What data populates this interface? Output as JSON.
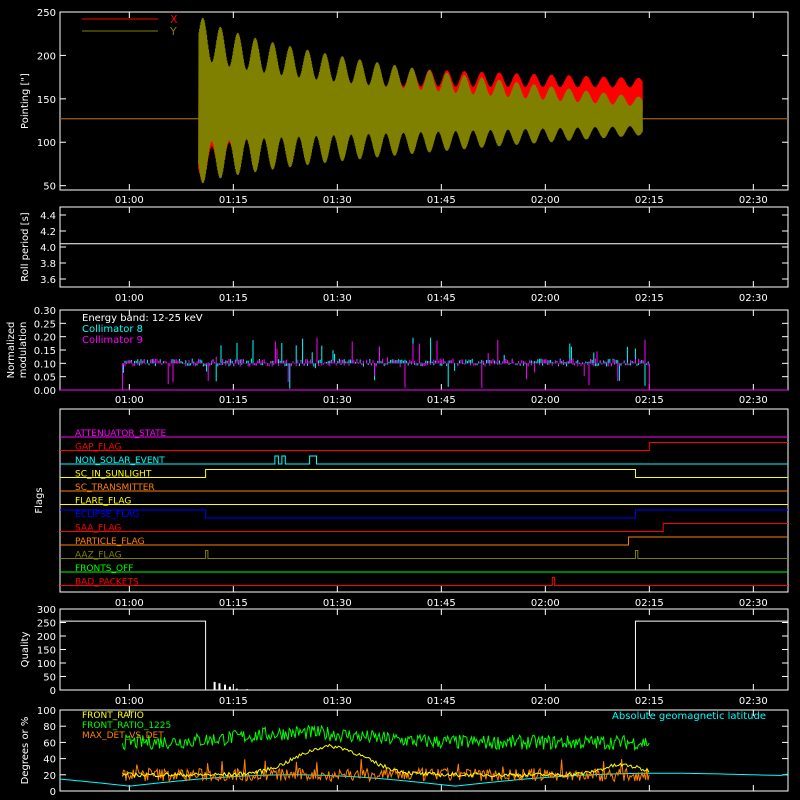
{
  "time_ticks": [
    "01:00",
    "01:15",
    "01:30",
    "01:45",
    "02:00",
    "02:15",
    "02:30"
  ],
  "chart_data": [
    {
      "type": "line",
      "panel": "pointing",
      "ylabel": "Pointing [\"]",
      "ylim": [
        45,
        250
      ],
      "yticks": [
        "50",
        "100",
        "150",
        "200",
        "250"
      ],
      "legend": [
        {
          "name": "X",
          "color": "#ff0000"
        },
        {
          "name": "Y",
          "color": "#808000"
        }
      ],
      "series": [
        {
          "name": "X",
          "color": "#ff0000",
          "baseline": 127,
          "start": "01:10",
          "end": "02:14",
          "amp_start": 75,
          "amp_end": 22,
          "center_start": 125,
          "center_end": 152
        },
        {
          "name": "Y",
          "color": "#808000",
          "baseline": 127,
          "start": "01:10",
          "end": "02:14",
          "amp_start": 100,
          "amp_end": 22,
          "center_start": 150,
          "center_end": 130
        }
      ]
    },
    {
      "type": "line",
      "panel": "roll",
      "ylabel": "Roll period [s]",
      "ylim": [
        3.5,
        4.5
      ],
      "yticks": [
        "3.6",
        "3.8",
        "4.0",
        "4.2",
        "4.4"
      ],
      "series": [
        {
          "name": "roll",
          "color": "#ffffff",
          "value": 4.04
        }
      ]
    },
    {
      "type": "bar",
      "panel": "modulation",
      "ylabel": "Normalized modulation",
      "ylim": [
        0,
        0.3
      ],
      "yticks": [
        "0.00",
        "0.05",
        "0.10",
        "0.15",
        "0.20",
        "0.25",
        "0.30"
      ],
      "legend": [
        {
          "name": "Energy band: 12-25 keV",
          "color": "#ffffff"
        },
        {
          "name": "Collimator 8",
          "color": "#00ffff"
        },
        {
          "name": "Collimator 9",
          "color": "#ff00ff"
        }
      ],
      "start": "00:59",
      "end": "02:15",
      "level": 0.1
    },
    {
      "type": "line",
      "panel": "flags",
      "ylabel": "Flags",
      "flags": [
        {
          "name": "ATTENUATOR_STATE",
          "color": "#ff00ff",
          "steps": []
        },
        {
          "name": "GAP_FLAG",
          "color": "#ff0000",
          "steps": [
            [
              "02:15",
              1
            ]
          ]
        },
        {
          "name": "NON_SOLAR_EVENT",
          "color": "#00ffff",
          "pulses": [
            [
              "01:21",
              "01:21:30"
            ],
            [
              "01:22",
              "01:22:30"
            ],
            [
              "01:26",
              "01:27"
            ]
          ]
        },
        {
          "name": "SC_IN_SUNLIGHT",
          "color": "#ffff00",
          "init": 0,
          "steps": [
            [
              "01:11",
              1
            ],
            [
              "02:13",
              0
            ]
          ]
        },
        {
          "name": "SC_TRANSMITTER",
          "color": "#ff8000",
          "steps": []
        },
        {
          "name": "FLARE_FLAG",
          "color": "#ffff00",
          "steps": []
        },
        {
          "name": "ECLIPSE_FLAG",
          "color": "#0000ff",
          "init": 1,
          "steps": [
            [
              "01:11",
              0
            ],
            [
              "02:13",
              1
            ]
          ]
        },
        {
          "name": "SAA_FLAG",
          "color": "#ff0000",
          "steps": [
            [
              "02:17",
              1
            ]
          ]
        },
        {
          "name": "PARTICLE_FLAG",
          "color": "#ff8000",
          "steps": [
            [
              "02:12",
              1
            ]
          ]
        },
        {
          "name": "AAZ_FLAG",
          "color": "#808000",
          "pulses": [
            [
              "01:11",
              "01:11:20"
            ],
            [
              "02:13",
              "02:13:20"
            ]
          ]
        },
        {
          "name": "FRONTS_OFF",
          "color": "#00ff00",
          "steps": []
        },
        {
          "name": "BAD_PACKETS",
          "color": "#ff0000",
          "pulses": [
            [
              "02:01",
              "02:01:20"
            ]
          ]
        }
      ]
    },
    {
      "type": "line",
      "panel": "quality",
      "ylabel": "Quality",
      "ylim": [
        0,
        300
      ],
      "yticks": [
        "0",
        "50",
        "100",
        "150",
        "200",
        "250",
        "300"
      ],
      "series": [
        {
          "name": "quality",
          "color": "#ffffff",
          "high": 255,
          "high_end": "01:11",
          "high_start": "02:13"
        }
      ]
    },
    {
      "type": "line",
      "panel": "front_ratio",
      "ylabel": "Degrees or %",
      "ylim": [
        0,
        100
      ],
      "yticks": [
        "0",
        "20",
        "40",
        "60",
        "80",
        "100"
      ],
      "annotation": "Absolute geomagnetic latitude",
      "legend": [
        {
          "name": "FRONT_RATIO",
          "color": "#ffff00"
        },
        {
          "name": "FRONT_RATIO_1225",
          "color": "#00ff00"
        },
        {
          "name": "MAX_DET_VS_DET",
          "color": "#ff8000"
        }
      ]
    }
  ]
}
